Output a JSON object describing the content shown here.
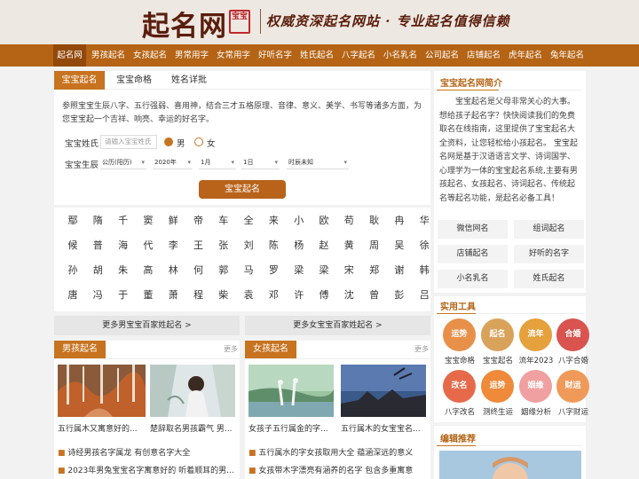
{
  "header": {
    "logo_text": "起名网",
    "logo_seal": "宝宝",
    "slogan": "权威资深起名网站 · 专业起名值得信赖"
  },
  "nav": [
    "起名网",
    "男孩起名",
    "女孩起名",
    "男常用字",
    "女常用字",
    "好听名字",
    "姓氏起名",
    "八字起名",
    "小名乳名",
    "公司起名",
    "店铺起名",
    "虎年起名",
    "兔年起名"
  ],
  "naming_panel": {
    "tabs": [
      "宝宝起名",
      "宝宝命格",
      "姓名详批"
    ],
    "intro": "参照宝宝生辰八字、五行强弱、喜用神，结合三才五格原理、音律、意义、美学、书写等诸多方面，为您宝宝起一个吉祥、响亮、幸运的好名字。",
    "surname_label": "宝宝姓氏",
    "surname_placeholder": "请输入宝宝姓氏",
    "gender_male": "男",
    "gender_female": "女",
    "birth_label": "宝宝生辰",
    "calendar_value": "公历(阳历)",
    "year_value": "2020年",
    "month_value": "1月",
    "day_value": "1日",
    "hour_value": "时辰未知",
    "submit_label": "宝宝起名"
  },
  "surnames": [
    [
      "鄢",
      "隋",
      "千",
      "窦",
      "鲜",
      "帝",
      "车",
      "全",
      "来",
      "小",
      "欧",
      "苟",
      "耿",
      "冉",
      "华"
    ],
    [
      "候",
      "普",
      "海",
      "代",
      "李",
      "王",
      "张",
      "刘",
      "陈",
      "杨",
      "赵",
      "黄",
      "周",
      "吴",
      "徐"
    ],
    [
      "孙",
      "胡",
      "朱",
      "高",
      "林",
      "何",
      "郭",
      "马",
      "罗",
      "梁",
      "梁",
      "宋",
      "郑",
      "谢",
      "韩"
    ],
    [
      "唐",
      "冯",
      "于",
      "董",
      "萧",
      "程",
      "柴",
      "袁",
      "邓",
      "许",
      "傅",
      "沈",
      "曾",
      "彭",
      "吕"
    ]
  ],
  "more_links": {
    "boy": "更多男宝宝百家姓起名 >",
    "girl": "更多女宝宝百家姓起名 >"
  },
  "boy_section": {
    "title": "男孩起名",
    "more": "更多",
    "captions": [
      "五行属木又寓意好的...",
      "楚辞取名男孩霸气 男..."
    ],
    "list": [
      "诗经男孩名字属龙 有创意名字大全",
      "2023年男兔宝宝名字寓意好的 听着顺耳的男..."
    ]
  },
  "girl_section": {
    "title": "女孩起名",
    "more": "更多",
    "captions": [
      "女孩子五行属金的字...",
      "五行属木的女宝宝名..."
    ],
    "list": [
      "五行属水的字女孩取用大全 蕴涵深远的意义",
      "女孩带木字漂亮有涵养的名字 包含多重寓意"
    ]
  },
  "sidebar": {
    "intro_title": "宝宝起名网简介",
    "intro_text": "宝宝起名是父母非常关心的大事。想给孩子起名字？快快阅读我们的免费取名在线指南，这里提供了宝宝起名大全资料，让您轻松给小孩起名。 宝宝起名网是基于汉语语言文学、诗词国学、心理学为一体的宝宝起名系统,主要有男孩起名、女孩起名、诗词起名、传统起名等起名功能，是起名必备工具！",
    "links": [
      "微信网名",
      "组词起名",
      "店铺起名",
      "好听的名字",
      "小名乳名",
      "姓氏起名"
    ],
    "tools_title": "实用工具",
    "tools": [
      {
        "label": "宝宝命格",
        "icon": "运势",
        "color": "#e8904a"
      },
      {
        "label": "宝宝起名",
        "icon": "起名",
        "color": "#d9a25a"
      },
      {
        "label": "流年2023",
        "icon": "流年",
        "color": "#e4a13c"
      },
      {
        "label": "八字合婚",
        "icon": "合婚",
        "color": "#d9534f"
      },
      {
        "label": "八字改名",
        "icon": "改名",
        "color": "#e66a4a"
      },
      {
        "label": "测终生运",
        "icon": "运势",
        "color": "#ef8a3a"
      },
      {
        "label": "姻缘分析",
        "icon": "姻缘",
        "color": "#f0a0a0"
      },
      {
        "label": "八字财运",
        "icon": "财运",
        "color": "#f09a5a"
      }
    ],
    "editor_title": "编辑推荐"
  },
  "colors": {
    "brand": "#b56415",
    "nav_active": "#93490b",
    "accent": "#c77320"
  }
}
